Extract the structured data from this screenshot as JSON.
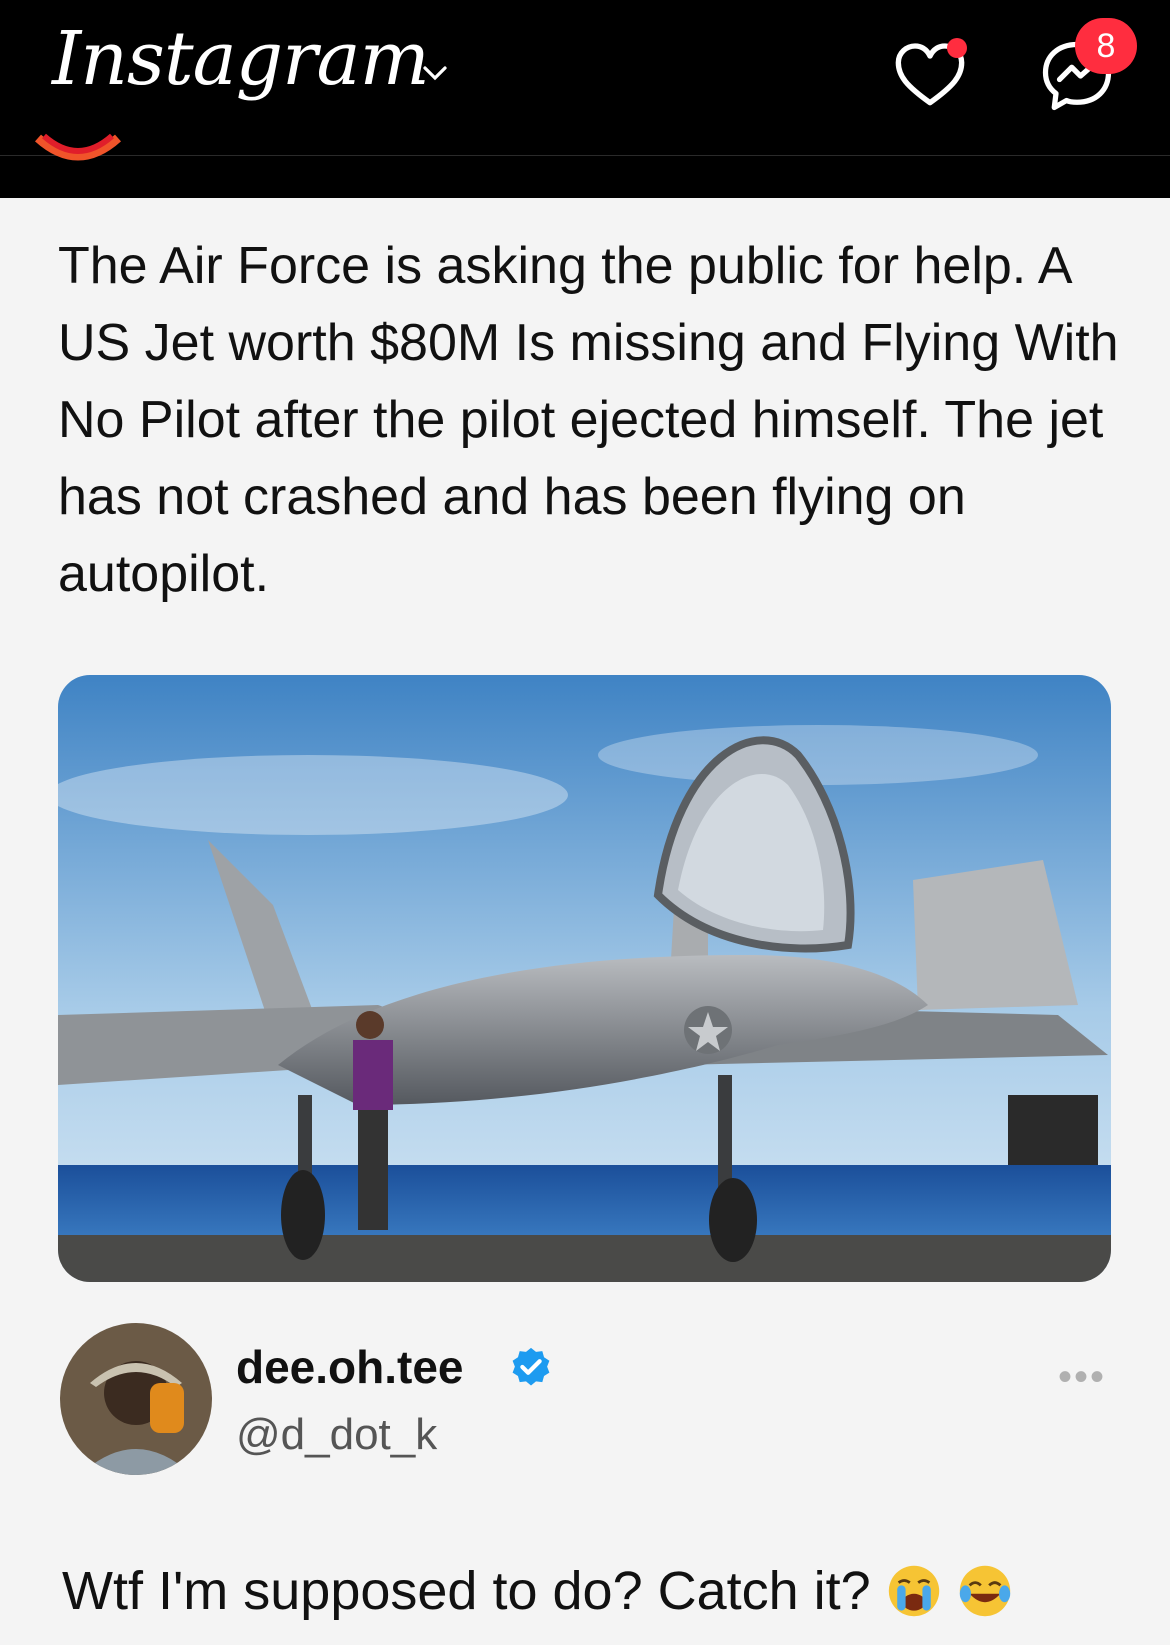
{
  "header": {
    "app_name": "Instagram",
    "messages_badge": "8"
  },
  "post": {
    "text": "The Air Force is asking the public for help. A US Jet worth $80M Is missing and Flying With No Pilot after the pilot ejected himself. The jet has not crashed and has been flying on autopilot."
  },
  "author": {
    "name": "dee.oh.tee",
    "handle": "@d_dot_k",
    "more": "•••"
  },
  "reply": {
    "text": "Wtf I'm supposed to do? Catch it? "
  },
  "colors": {
    "accent": "#ff2d3f",
    "verified": "#1d9bf0"
  }
}
